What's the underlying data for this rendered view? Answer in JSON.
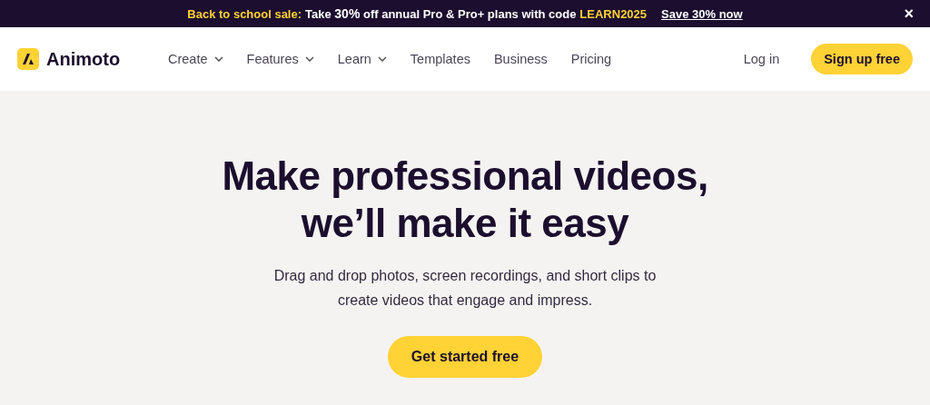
{
  "promo_banner": {
    "label": "Back to school sale:",
    "text": "Take **30%** off annual Pro & Pro+ plans with code",
    "code": "LEARN2025",
    "link": "Save 30% now",
    "close": "×"
  },
  "nav": {
    "logo": "Animoto",
    "items": [
      {
        "label": "Create",
        "kind": "dropdown"
      },
      {
        "label": "Features",
        "kind": "dropdown"
      },
      {
        "label": "Learn",
        "kind": "dropdown"
      },
      {
        "label": "Templates",
        "kind": "link"
      },
      {
        "label": "Business",
        "kind": "link"
      },
      {
        "label": "Pricing",
        "kind": "link"
      }
    ],
    "login": "Log in",
    "signup": "Sign up free"
  },
  "hero": {
    "headline_lines": [
      "Make professional videos,",
      "we’ll make it easy"
    ],
    "subtitle_lines": [
      "Drag and drop photos, screen recordings, and short clips to",
      "create videos that engage and impress."
    ],
    "cta": "Get started free"
  }
}
